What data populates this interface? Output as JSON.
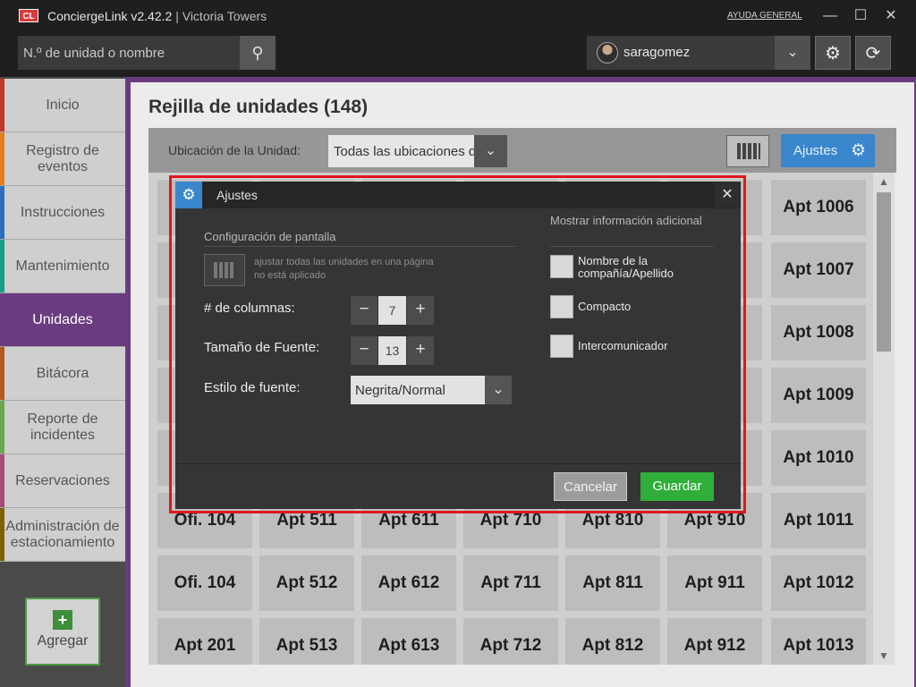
{
  "titlebar": {
    "logo": "CL",
    "app_name": "ConciergeLink v2.42.2",
    "separator": " | ",
    "building": "Victoria Towers",
    "help": "AYUDA GENERAL",
    "minimize": "—",
    "maximize": "☐",
    "close": "✕"
  },
  "topbar": {
    "search_placeholder": "N.º de unidad o nombre",
    "search_icon": "search-icon",
    "username": "saragomez",
    "dropdown_icon": "chevron-down-icon",
    "settings_icon": "gear-icon",
    "refresh_icon": "refresh-icon"
  },
  "sidebar": {
    "items": [
      {
        "label": "Inicio",
        "color": "#c0392b"
      },
      {
        "label": "Registro de eventos",
        "color": "#e67e22"
      },
      {
        "label": "Instrucciones",
        "color": "#2c6fbb"
      },
      {
        "label": "Mantenimiento",
        "color": "#16a085"
      },
      {
        "label": "Unidades",
        "color": "#6b3b7f"
      },
      {
        "label": "Bitácora",
        "color": "#b35a1f"
      },
      {
        "label": "Reporte de incidentes",
        "color": "#6aa84f"
      },
      {
        "label": "Reservaciones",
        "color": "#a64d79"
      },
      {
        "label": "Administración de estacionamiento",
        "color": "#7f6000"
      }
    ],
    "add_label": "Agregar"
  },
  "main": {
    "title": "Rejilla de unidades (148)",
    "location_label": "Ubicación de la Unidad:",
    "location_value": "Todas las ubicaciones de unidad",
    "settings_button": "Ajustes",
    "tiles": [
      [
        "",
        "",
        "",
        "",
        "",
        "",
        "Apt 1006"
      ],
      [
        "",
        "",
        "",
        "",
        "",
        "",
        "Apt 1007"
      ],
      [
        "",
        "",
        "",
        "",
        "",
        "",
        "Apt 1008"
      ],
      [
        "",
        "",
        "",
        "",
        "",
        "",
        "Apt 1009"
      ],
      [
        "",
        "",
        "",
        "",
        "",
        "",
        "Apt 1010"
      ],
      [
        "Ofi. 104",
        "Apt 511",
        "Apt 611",
        "Apt 710",
        "Apt 810",
        "Apt 910",
        "Apt 1011"
      ],
      [
        "Ofi. 104",
        "Apt 512",
        "Apt 612",
        "Apt 711",
        "Apt 811",
        "Apt 911",
        "Apt 1012"
      ],
      [
        "Apt 201",
        "Apt 513",
        "Apt 613",
        "Apt 712",
        "Apt 812",
        "Apt 912",
        "Apt 1013"
      ]
    ]
  },
  "modal": {
    "title": "Ajustes",
    "display_config_title": "Configuración de pantalla",
    "fit_text_line1": "ajustar todas las unidades en una página",
    "fit_text_line2": "no está aplicado",
    "columns_label": "# de columnas:",
    "columns_value": "7",
    "font_size_label": "Tamaño de Fuente:",
    "font_size_value": "13",
    "font_style_label": "Estilo de fuente:",
    "font_style_value": "Negrita/Normal",
    "additional_title": "Mostrar información adicional",
    "checkboxes": [
      {
        "label": "Nombre de la compañía/Apellido",
        "checked": false
      },
      {
        "label": "Compacto",
        "checked": false
      },
      {
        "label": "Intercomunicador",
        "checked": false
      }
    ],
    "cancel": "Cancelar",
    "save": "Guardar",
    "highlight_color": "#e0161d"
  }
}
